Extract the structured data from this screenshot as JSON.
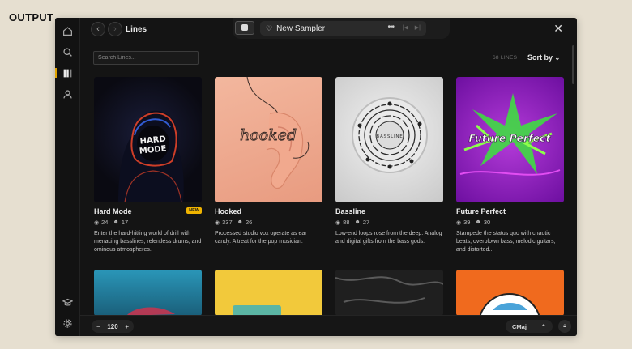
{
  "brand": "OUTPUT",
  "header": {
    "title": "Lines",
    "sampler_name": "New Sampler"
  },
  "toolbar": {
    "search_placeholder": "Search Lines...",
    "count": "68 LINES",
    "sort_label": "Sort by"
  },
  "cards": [
    {
      "title": "Hard Mode",
      "badge": "NEW",
      "plays": "24",
      "likes": "17",
      "desc": "Enter the hard-hitting world of drill with menacing basslines, relentless drums, and ominous atmospheres.",
      "art_text": "HARD MODE"
    },
    {
      "title": "Hooked",
      "badge": "",
      "plays": "337",
      "likes": "26",
      "desc": "Processed studio vox operate as ear candy. A treat for the pop musician.",
      "art_text": "hooked"
    },
    {
      "title": "Bassline",
      "badge": "",
      "plays": "88",
      "likes": "27",
      "desc": "Low-end loops rose from the deep. Analog and digital gifts from the bass gods.",
      "art_text": "BASSLINE"
    },
    {
      "title": "Future Perfect",
      "badge": "",
      "plays": "39",
      "likes": "30",
      "desc": "Stampede the status quo with chaotic beats, overblown bass, melodic guitars, and distorted...",
      "art_text": "Future Perfect"
    }
  ],
  "footer": {
    "tempo": "120",
    "key": "CMaj"
  },
  "colors": {
    "accent": "#f0b400",
    "background": "#141414",
    "outer": "#e6dfd0"
  }
}
